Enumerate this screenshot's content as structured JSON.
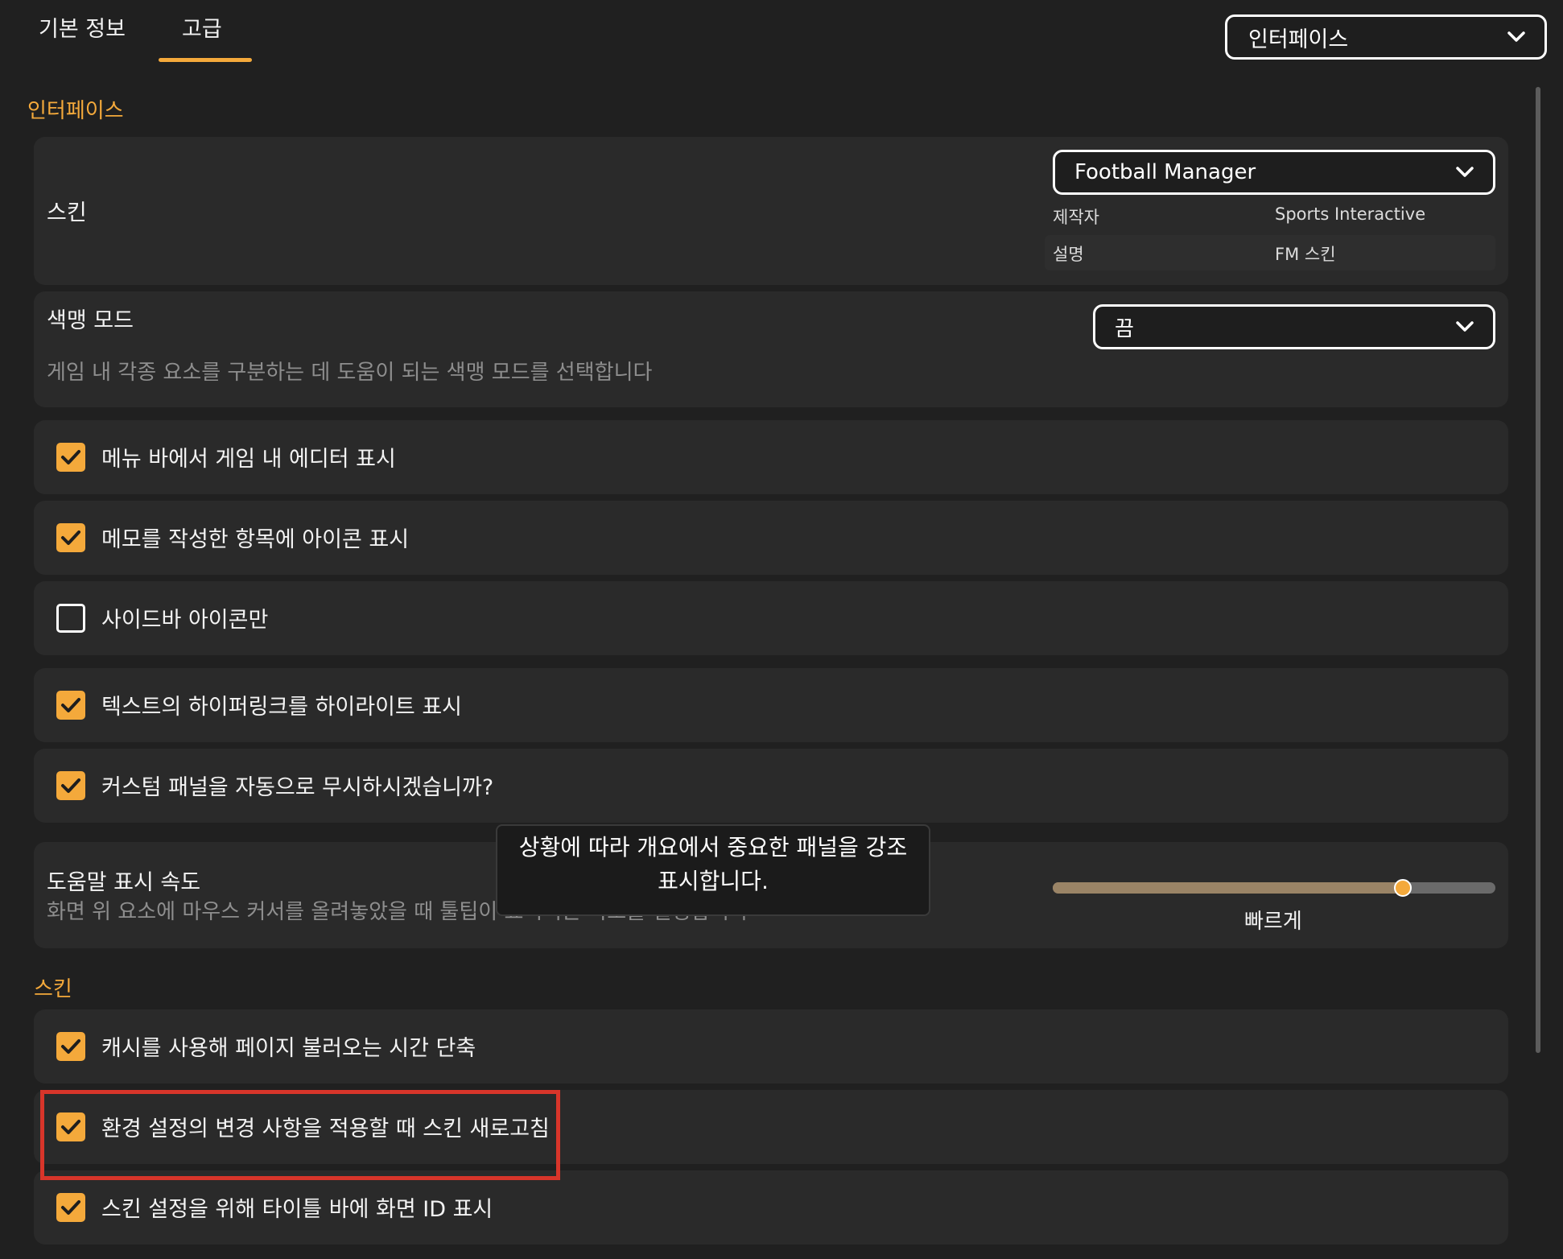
{
  "tabs": [
    {
      "label": "기본 정보"
    },
    {
      "label": "고급",
      "active": true
    }
  ],
  "top_dropdown": {
    "value": "인터페이스"
  },
  "sections": {
    "interface_title": "인터페이스",
    "skin_title": "스킨"
  },
  "skin": {
    "label": "스킨",
    "dropdown_value": "Football Manager",
    "author_key": "제작자",
    "author_value": "Sports Interactive",
    "desc_key": "설명",
    "desc_value": "FM 스킨"
  },
  "color_mode": {
    "label": "색맹 모드",
    "description": "게임 내 각종 요소를 구분하는 데 도움이 되는 색맹 모드를 선택합니다",
    "dropdown_value": "끔"
  },
  "options": [
    {
      "label": "메뉴 바에서 게임 내 에디터 표시",
      "checked": true
    },
    {
      "label": "메모를 작성한 항목에 아이콘 표시",
      "checked": true
    },
    {
      "label": "사이드바 아이콘만",
      "checked": false
    },
    {
      "label": "텍스트의 하이퍼링크를 하이라이트 표시",
      "checked": true
    },
    {
      "label": "커스텀 패널을 자동으로 무시하시겠습니까?",
      "checked": true
    }
  ],
  "help_speed": {
    "label": "도움말 표시 속도",
    "description": "화면 위 요소에 마우스 커서를 올려놓았을 때 툴팁이 표시되는 속도를 설정합니다",
    "value_label": "빠르게",
    "level": 0.79
  },
  "tooltip": {
    "line1": "상황에 따라 개요에서 중요한 패널을 강조",
    "line2": "표시합니다."
  },
  "skin_options": [
    {
      "label": "캐시를 사용해 페이지 불러오는 시간 단축",
      "checked": true
    },
    {
      "label": "환경 설정의 변경 사항을 적용할 때 스킨 새로고침",
      "checked": true
    },
    {
      "label": "스킨 설정을 위해 타이틀 바에 화면 ID 표시",
      "checked": true
    }
  ],
  "colors": {
    "accent": "#f4a93b",
    "background": "#202020",
    "card": "#2a2a2a",
    "highlight": "#d8352a"
  }
}
